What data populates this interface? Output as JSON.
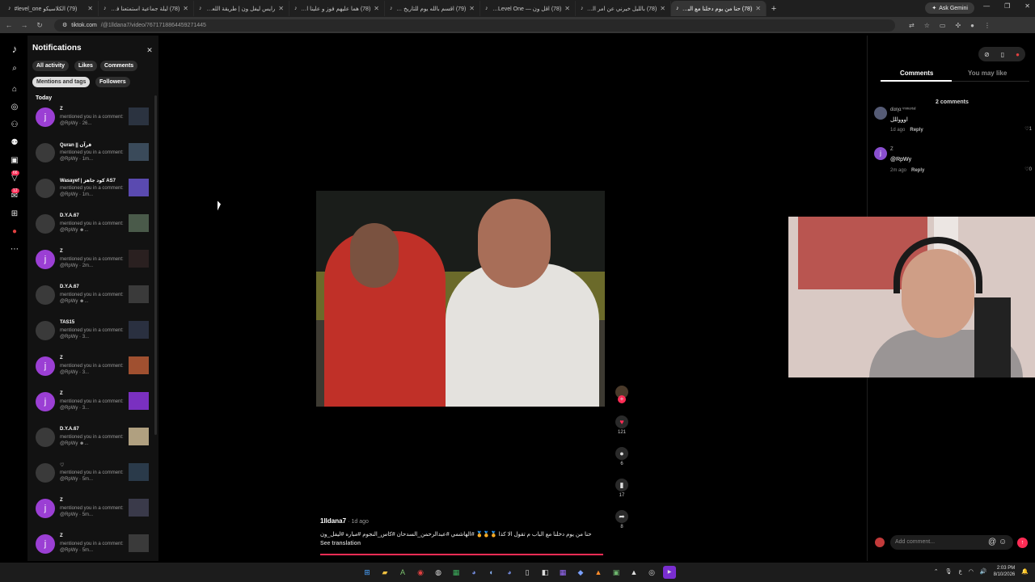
{
  "browser": {
    "tabs": [
      {
        "title": "(79) الكلاسيكو level_one#"
      },
      {
        "title": "(78) ليلة جماعية استمتعنا فيها جدا"
      },
      {
        "title": "رايس ليفل ون | طريقة اللعب ون"
      },
      {
        "title": "(78) هما عليهم فوز و علينا الطرد"
      },
      {
        "title": "(79) اقسم بالله يوم للتاريخ يا بشر"
      },
      {
        "title": "(78) اقل ون — Level One تشكيلة"
      },
      {
        "title": "(78) بالليل خيرني عن امر المعاناة"
      },
      {
        "title": "(78) حنا من يوم دخلنا مع الباب م"
      }
    ],
    "gemini_label": "Ask Gemini",
    "url_host": "tiktok.com",
    "url_path": "/@1lldana7/video/7671718864459271445"
  },
  "notifications": {
    "title": "Notifications",
    "filters": [
      "All activity",
      "Likes",
      "Comments",
      "Mentions and tags",
      "Followers"
    ],
    "section": "Today",
    "items": [
      {
        "name": "Z",
        "avatar": "j",
        "text": "mentioned you in a comment: @RpWy · 26..."
      },
      {
        "name": "Quran || قرآن",
        "avatar": "",
        "text": "mentioned you in a comment: @RpWy · 1m..."
      },
      {
        "name": "Wasayef | كود جاهز AS7",
        "avatar": "",
        "text": "mentioned you in a comment: @RpWy · 1m..."
      },
      {
        "name": "D.Y.A.67",
        "avatar": "",
        "text": "mentioned you in a comment: @RpWy ☻..."
      },
      {
        "name": "Z",
        "avatar": "j",
        "text": "mentioned you in a comment: @RpWy · 2m..."
      },
      {
        "name": "D.Y.A.67",
        "avatar": "",
        "text": "mentioned you in a comment: @RpWy ☻..."
      },
      {
        "name": "TAS15",
        "avatar": "",
        "text": "mentioned you in a comment: @RpWy · 3..."
      },
      {
        "name": "Z",
        "avatar": "j",
        "text": "mentioned you in a comment: @RpWy · 3..."
      },
      {
        "name": "Z",
        "avatar": "j",
        "text": "mentioned you in a comment: @RpWy · 3..."
      },
      {
        "name": "D.Y.A.67",
        "avatar": "",
        "text": "mentioned you in a comment: @RpWy ☻..."
      },
      {
        "name": "♡",
        "avatar": "",
        "text": "mentioned you in a comment: @RpWy · 5m..."
      },
      {
        "name": "Z",
        "avatar": "j",
        "text": "mentioned you in a comment: @RpWy · 5m..."
      },
      {
        "name": "Z",
        "avatar": "j",
        "text": "mentioned you in a comment: @RpWy · 5m..."
      }
    ]
  },
  "rail": {
    "badge_inbox": "66",
    "badge_messages": "12"
  },
  "video": {
    "likes": "121",
    "comments": "6",
    "saves": "17",
    "shares": "8",
    "author": "1lldana7",
    "posted": "· 1d ago",
    "caption": "حنا من يوم دخلنا مع الباب م تقول الا كذا 🏅🏅🏅 #الهاشمي #عبدالرحمن_السدحان #كاس_النجوم #مباره #ليفل_ون",
    "see_translation": "See translation"
  },
  "comments_panel": {
    "tab_comments": "Comments",
    "tab_you_may_like": "You may like",
    "count_text": "2 comments",
    "items": [
      {
        "user": "ɗαɳα ⁱᵐᵐᵒʳᵗᵃˡ",
        "text": "اوووللل",
        "meta": "1d ago",
        "reply": "Reply",
        "likes": "1"
      },
      {
        "user": "Z",
        "text": "@RpWy",
        "meta": "2m ago",
        "reply": "Reply",
        "likes": "0"
      }
    ],
    "input_placeholder": "Add comment..."
  },
  "taskbar": {
    "time": "2:03 PM",
    "date": "8/10/2026",
    "lang": "ع"
  },
  "colors": {
    "accent": "#fe2c55",
    "panel": "#121212",
    "avatar_purple": "#9b3fd4"
  }
}
